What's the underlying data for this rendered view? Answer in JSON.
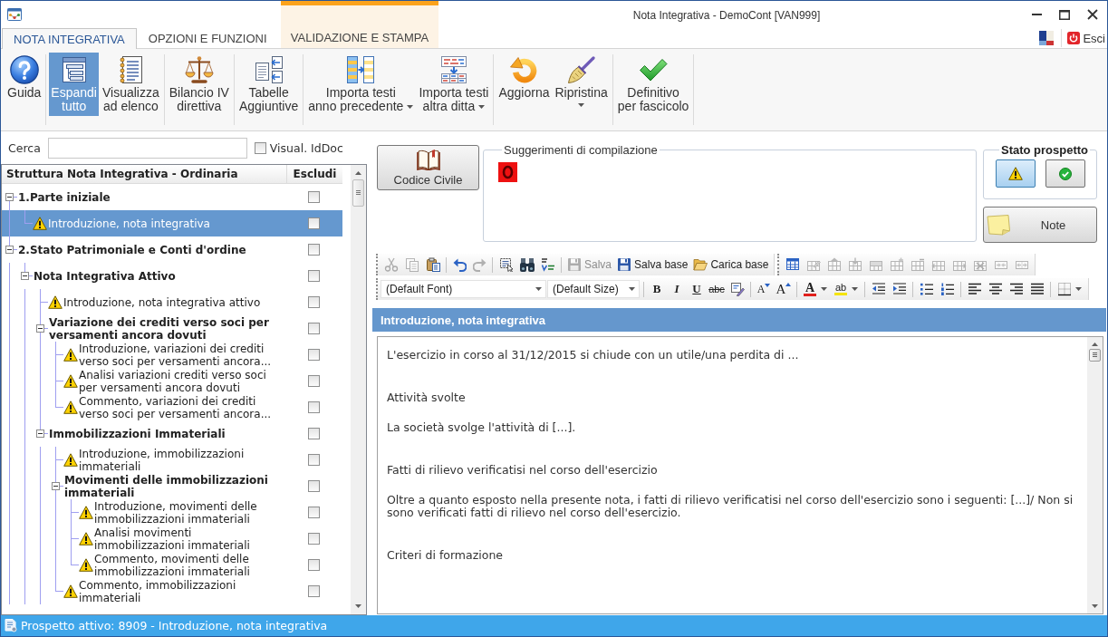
{
  "window": {
    "title": "Nota Integrativa - DemoCont [VAN999]"
  },
  "ribbon": {
    "tabs": [
      {
        "label": "NOTA INTEGRATIVA",
        "selected": true,
        "contextual": false
      },
      {
        "label": "OPZIONI E FUNZIONI",
        "selected": false,
        "contextual": false
      },
      {
        "label": "VALIDAZIONE E STAMPA",
        "selected": false,
        "contextual": true
      }
    ],
    "exit_button": {
      "label": "Esci"
    },
    "groups": [
      {
        "buttons": [
          {
            "kind": "help",
            "label": "Guida",
            "pressed": false,
            "dropdown": false
          }
        ]
      },
      {
        "buttons": [
          {
            "kind": "expand-all",
            "label": "Espandi tutto",
            "pressed": true,
            "dropdown": false
          },
          {
            "kind": "list-view",
            "label": "Visualizza ad elenco",
            "pressed": false,
            "dropdown": false
          }
        ]
      },
      {
        "buttons": [
          {
            "kind": "balance",
            "label": "Bilancio IV direttiva",
            "pressed": false,
            "dropdown": false
          }
        ]
      },
      {
        "buttons": [
          {
            "kind": "tables",
            "label": "Tabelle Aggiuntive",
            "pressed": false,
            "dropdown": false
          }
        ]
      },
      {
        "buttons": [
          {
            "kind": "import-previous",
            "label": "Importa testi anno precedente",
            "pressed": false,
            "dropdown": true
          },
          {
            "kind": "import-other",
            "label": "Importa testi altra ditta",
            "pressed": false,
            "dropdown": true
          }
        ]
      },
      {
        "buttons": [
          {
            "kind": "refresh",
            "label": "Aggiorna",
            "pressed": false,
            "dropdown": false
          },
          {
            "kind": "reset",
            "label": "Ripristina",
            "pressed": false,
            "dropdown": true
          }
        ]
      },
      {
        "buttons": [
          {
            "kind": "final",
            "label": "Definitivo per fascicolo",
            "pressed": false,
            "dropdown": false
          }
        ]
      }
    ]
  },
  "search": {
    "label": "Cerca"
  },
  "id_doc": {
    "label": "Visual. IdDoc",
    "checked": false
  },
  "tree": {
    "columns": [
      "Struttura Nota Integrativa - Ordinaria",
      "Escludi"
    ],
    "nodes": [
      {
        "label": "1.Parte iniziale",
        "expanded": true,
        "selected": false,
        "excluded": false,
        "children": [
          {
            "label": "Introduzione, nota integrativa",
            "warning": true,
            "selected": true,
            "excluded": false
          }
        ]
      },
      {
        "label": "2.Stato Patrimoniale e Conti d'ordine",
        "expanded": true,
        "selected": false,
        "excluded": false,
        "children": [
          {
            "label": "Nota Integrativa Attivo",
            "expanded": true,
            "selected": false,
            "excluded": false,
            "children": [
              {
                "label": "Introduzione, nota integrativa attivo",
                "warning": true,
                "selected": false,
                "excluded": false
              },
              {
                "label": "Variazione dei crediti verso soci per versamenti ancora dovuti",
                "expanded": true,
                "selected": false,
                "excluded": false,
                "children": [
                  {
                    "label": "Introduzione, variazioni dei crediti verso soci per versamenti ancora...",
                    "warning": true,
                    "selected": false,
                    "excluded": false
                  },
                  {
                    "label": "Analisi variazioni crediti verso soci per versamenti ancora dovuti",
                    "warning": true,
                    "selected": false,
                    "excluded": false
                  },
                  {
                    "label": "Commento, variazioni dei crediti verso soci per versamenti ancora...",
                    "warning": true,
                    "selected": false,
                    "excluded": false
                  }
                ]
              },
              {
                "label": "Immobilizzazioni Immateriali",
                "expanded": true,
                "selected": false,
                "excluded": false,
                "children": [
                  {
                    "label": "Introduzione, immobilizzazioni immateriali",
                    "warning": true,
                    "selected": false,
                    "excluded": false
                  },
                  {
                    "label": "Movimenti delle immobilizzazioni immateriali",
                    "expanded": true,
                    "selected": false,
                    "excluded": false,
                    "children": [
                      {
                        "label": "Introduzione, movimenti delle immobilizzazioni immateriali",
                        "warning": true,
                        "selected": false,
                        "excluded": false
                      },
                      {
                        "label": "Analisi movimenti immobilizzazioni immateriali",
                        "warning": true,
                        "selected": false,
                        "excluded": false
                      },
                      {
                        "label": "Commento, movimenti delle immobilizzazioni immateriali",
                        "warning": true,
                        "selected": false,
                        "excluded": false
                      }
                    ]
                  },
                  {
                    "label": "Commento, immobilizzazioni immateriali",
                    "warning": true,
                    "selected": false,
                    "excluded": false
                  }
                ]
              }
            ]
          }
        ]
      }
    ]
  },
  "codice_civile": {
    "label": "Codice Civile"
  },
  "suggestions": {
    "title": "Suggerimenti di compilazione"
  },
  "status_panel": {
    "title": "Stato prospetto",
    "options": [
      {
        "kind": "warning",
        "selected": true
      },
      {
        "kind": "ok",
        "selected": false
      }
    ]
  },
  "note": {
    "label": "Note"
  },
  "toolbar_rows": [
    {
      "groups": [
        {
          "items": [
            {
              "kind": "cut",
              "disabled": true
            },
            {
              "kind": "copy",
              "disabled": true
            },
            {
              "kind": "paste",
              "disabled": false
            },
            {
              "kind": "separator"
            },
            {
              "kind": "undo",
              "disabled": false
            },
            {
              "kind": "redo",
              "disabled": true
            },
            {
              "kind": "separator"
            },
            {
              "kind": "select-all",
              "disabled": false
            },
            {
              "kind": "find",
              "disabled": false
            },
            {
              "kind": "spelling",
              "disabled": false
            },
            {
              "kind": "separator"
            },
            {
              "kind": "save",
              "label": "Salva",
              "disabled": true
            },
            {
              "kind": "save",
              "label": "Salva base",
              "disabled": false
            },
            {
              "kind": "open",
              "label": "Carica base",
              "disabled": false
            }
          ]
        },
        {
          "items": [
            {
              "kind": "table",
              "disabled": false
            },
            {
              "kind": "table-properties",
              "disabled": true
            },
            {
              "kind": "insert-rows-above",
              "disabled": true
            },
            {
              "kind": "insert-rows-below",
              "disabled": true
            },
            {
              "kind": "insert-cells",
              "disabled": true
            },
            {
              "kind": "insert-row",
              "disabled": true
            },
            {
              "kind": "delete-rows",
              "disabled": true
            },
            {
              "kind": "insert-column-left",
              "disabled": true
            },
            {
              "kind": "insert-column-right",
              "disabled": true
            },
            {
              "kind": "delete-cells",
              "disabled": true
            },
            {
              "kind": "merge-cells",
              "disabled": true
            },
            {
              "kind": "split-cells",
              "disabled": true
            }
          ]
        }
      ]
    },
    {
      "groups": [
        {
          "items": [
            {
              "kind": "font",
              "value": "(Default Font)"
            },
            {
              "kind": "size",
              "value": "(Default Size)"
            },
            {
              "kind": "separator"
            },
            {
              "kind": "bold",
              "label": "B",
              "disabled": false
            },
            {
              "kind": "italic",
              "label": "I",
              "disabled": false
            },
            {
              "kind": "underline",
              "label": "U",
              "disabled": false
            },
            {
              "kind": "strikethrough",
              "label": "abc",
              "disabled": false
            },
            {
              "kind": "proofing",
              "disabled": false
            },
            {
              "kind": "separator"
            },
            {
              "kind": "shrink-font",
              "label": "A",
              "disabled": false
            },
            {
              "kind": "grow-font",
              "label": "A",
              "disabled": false
            },
            {
              "kind": "separator"
            },
            {
              "kind": "font-color",
              "label": "A",
              "disabled": false,
              "dropdown": true
            },
            {
              "kind": "highlight",
              "label": "ab",
              "disabled": false,
              "dropdown": true
            },
            {
              "kind": "separator"
            },
            {
              "kind": "outdent",
              "disabled": false
            },
            {
              "kind": "indent",
              "disabled": false
            },
            {
              "kind": "separator"
            },
            {
              "kind": "bullets",
              "disabled": false
            },
            {
              "kind": "numbering",
              "disabled": false
            },
            {
              "kind": "separator"
            },
            {
              "kind": "align-left",
              "disabled": false
            },
            {
              "kind": "align-center",
              "disabled": false
            },
            {
              "kind": "align-right",
              "disabled": false
            },
            {
              "kind": "justify",
              "disabled": false
            },
            {
              "kind": "separator"
            },
            {
              "kind": "borders",
              "disabled": false,
              "dropdown": true
            }
          ]
        }
      ]
    }
  ],
  "section_title": "Introduzione, nota integrativa",
  "editor": {
    "blocks": [
      {
        "paragraphs": [
          "L'esercizio in corso al 31/12/2015 si chiude con un utile/una perdita di ..."
        ]
      },
      {
        "paragraphs": [
          "Attività svolte",
          "La società svolge l'attività di [...]."
        ]
      },
      {
        "paragraphs": [
          "Fatti di rilievo verificatisi nel corso dell'esercizio",
          "Oltre a quanto esposto nella presente nota, i fatti di rilievo verificatisi nel corso dell'esercizio sono i seguenti: [...]/ Non si sono verificati fatti di rilievo nel corso dell'esercizio."
        ]
      },
      {
        "paragraphs": [
          "Criteri di formazione"
        ]
      }
    ]
  },
  "status_bar": {
    "text": "Prospetto attivo: 8909 - Introduzione, nota integrativa"
  }
}
